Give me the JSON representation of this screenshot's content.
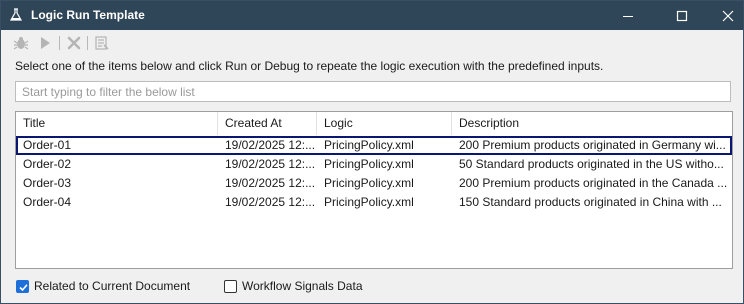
{
  "window": {
    "title": "Logic Run Template",
    "icon": "flask-icon"
  },
  "titlebar_buttons": [
    "minimize-icon",
    "maximize-icon",
    "close-icon"
  ],
  "toolbar": {
    "items": [
      "debug-bug-icon",
      "run-play-icon",
      "delete-x-icon",
      "properties-icon"
    ]
  },
  "instruction": "Select one of the items below and click Run or Debug to repeate the logic execution with the predefined inputs.",
  "filter": {
    "placeholder": "Start typing to filter the below list",
    "value": ""
  },
  "list": {
    "columns": [
      "Title",
      "Created At",
      "Logic",
      "Description"
    ],
    "rows": [
      {
        "title": "Order-01",
        "created_at": "19/02/2025 12:...",
        "logic": "PricingPolicy.xml",
        "description": "200 Premium products originated in Germany wi..."
      },
      {
        "title": "Order-02",
        "created_at": "19/02/2025 12:...",
        "logic": "PricingPolicy.xml",
        "description": "50 Standard products originated in the US witho..."
      },
      {
        "title": "Order-03",
        "created_at": "19/02/2025 12:...",
        "logic": "PricingPolicy.xml",
        "description": "200 Premium products originated in the Canada ..."
      },
      {
        "title": "Order-04",
        "created_at": "19/02/2025 12:...",
        "logic": "PricingPolicy.xml",
        "description": "150 Standard products originated in China with ..."
      }
    ],
    "selected_row": "Order-01"
  },
  "options": {
    "related_label": "Related to Current Document",
    "related_checked": true,
    "workflow_label": "Workflow Signals Data",
    "workflow_checked": false
  },
  "colors": {
    "titlebar": "#2f4558",
    "selection_outline": "#0a1770",
    "checkbox_checked": "#1e6fd9"
  }
}
